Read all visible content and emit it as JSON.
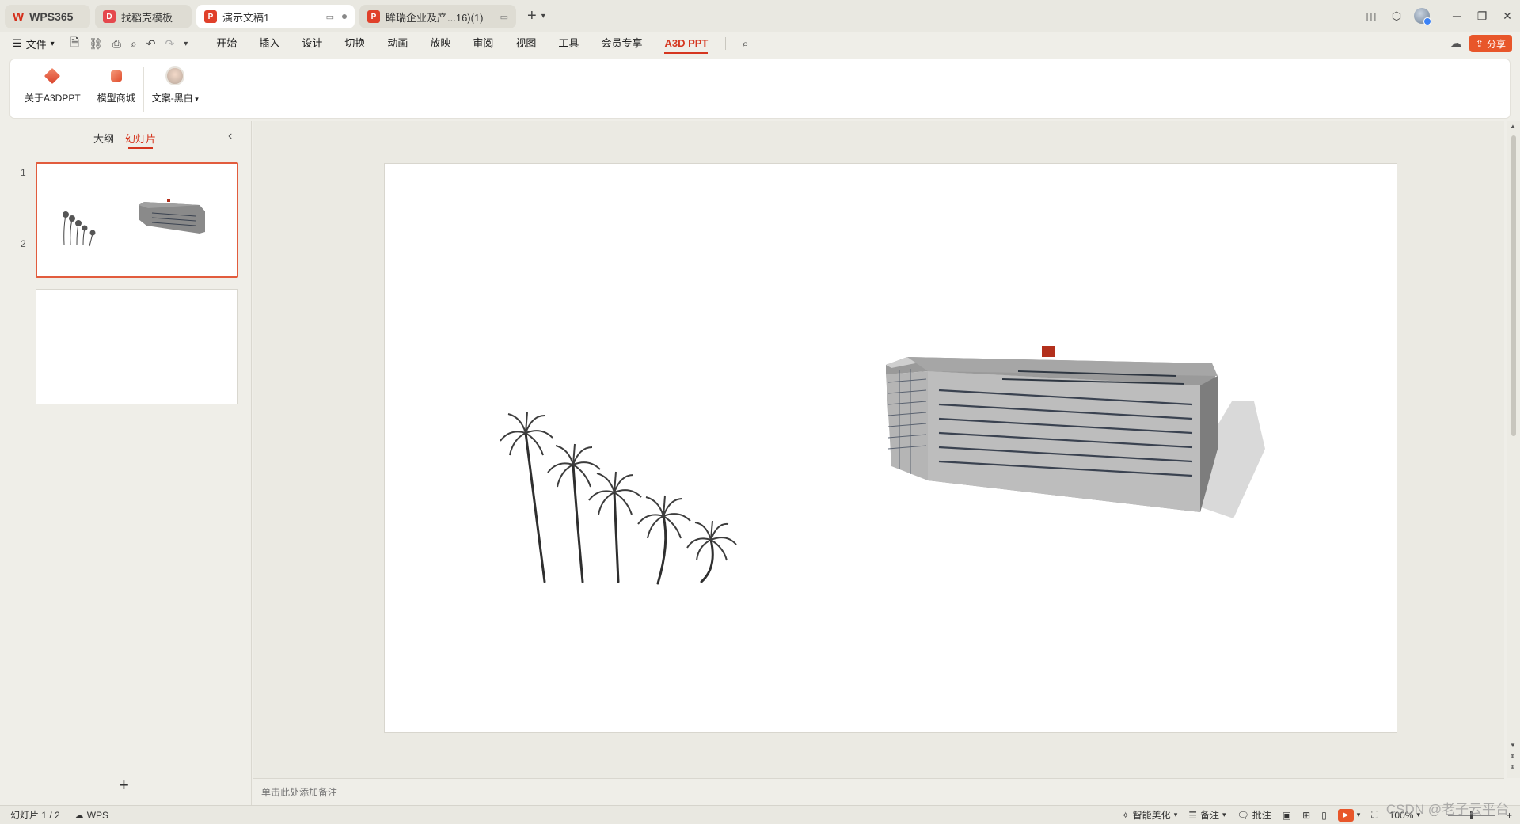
{
  "titlebar": {
    "tabs": [
      {
        "label": "WPS365",
        "logo": "W"
      },
      {
        "label": "找稻壳模板"
      },
      {
        "label": "演示文稿1"
      },
      {
        "label": "眸瑞企业及产...16)(1)"
      }
    ],
    "new_tab": "+"
  },
  "menubar": {
    "file_label": "文件",
    "menus": [
      "开始",
      "插入",
      "设计",
      "切换",
      "动画",
      "放映",
      "审阅",
      "视图",
      "工具",
      "会员专享",
      "A3D PPT"
    ],
    "active_menu": "A3D PPT",
    "share_label": "分享"
  },
  "ribbon": {
    "buttons": [
      {
        "label": "关于A3DPPT",
        "icon": "a3d-cube-icon"
      },
      {
        "label": "模型商城",
        "icon": "model-store-icon"
      },
      {
        "label": "文案-黑白",
        "icon": "theme-icon"
      }
    ]
  },
  "left_panel": {
    "tabs": [
      "大纲",
      "幻灯片"
    ],
    "active_tab": "幻灯片",
    "slide_numbers": [
      "1",
      "2"
    ],
    "add_label": "+"
  },
  "notes": {
    "placeholder": "单击此处添加备注"
  },
  "statusbar": {
    "slide_indicator": "幻灯片 1 / 2",
    "wps_label": "WPS",
    "smart_beautify": "智能美化",
    "notes_label": "备注",
    "comment_label": "批注",
    "zoom": "100%"
  },
  "watermark": "CSDN @老子云平台",
  "colors": {
    "accent": "#d5361f",
    "share": "#e8562a"
  }
}
